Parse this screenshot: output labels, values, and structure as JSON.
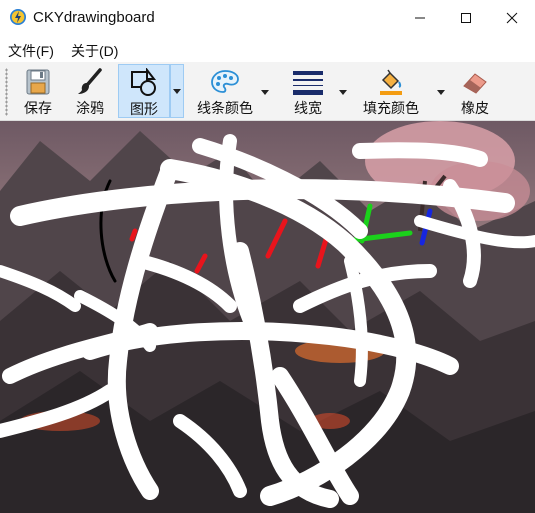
{
  "window": {
    "title": "CKYdrawingboard",
    "icon": "app-lightning-icon",
    "controls": [
      "minimize-icon",
      "maximize-icon",
      "close-icon"
    ]
  },
  "menu": {
    "items": [
      {
        "label": "文件(F)"
      },
      {
        "label": "关于(D)"
      }
    ]
  },
  "toolbar": {
    "items": [
      {
        "label": "保存",
        "icon": "save-icon"
      },
      {
        "label": "涂鸦",
        "icon": "brush-icon"
      },
      {
        "label": "图形",
        "icon": "shapes-icon",
        "selected": true
      },
      {
        "label": "线条颜色",
        "icon": "palette-icon"
      },
      {
        "label": "线宽",
        "icon": "line-width-icon"
      },
      {
        "label": "填充颜色",
        "icon": "paint-bucket-icon"
      },
      {
        "label": "橡皮",
        "icon": "eraser-icon"
      }
    ]
  },
  "canvas": {
    "background": "landscape painting with dark mountains, blossoming tree and sunset sky",
    "stroke_colors": [
      "#ffffff",
      "#e8141c",
      "#1bd11b",
      "#1626e0",
      "#000000"
    ]
  }
}
